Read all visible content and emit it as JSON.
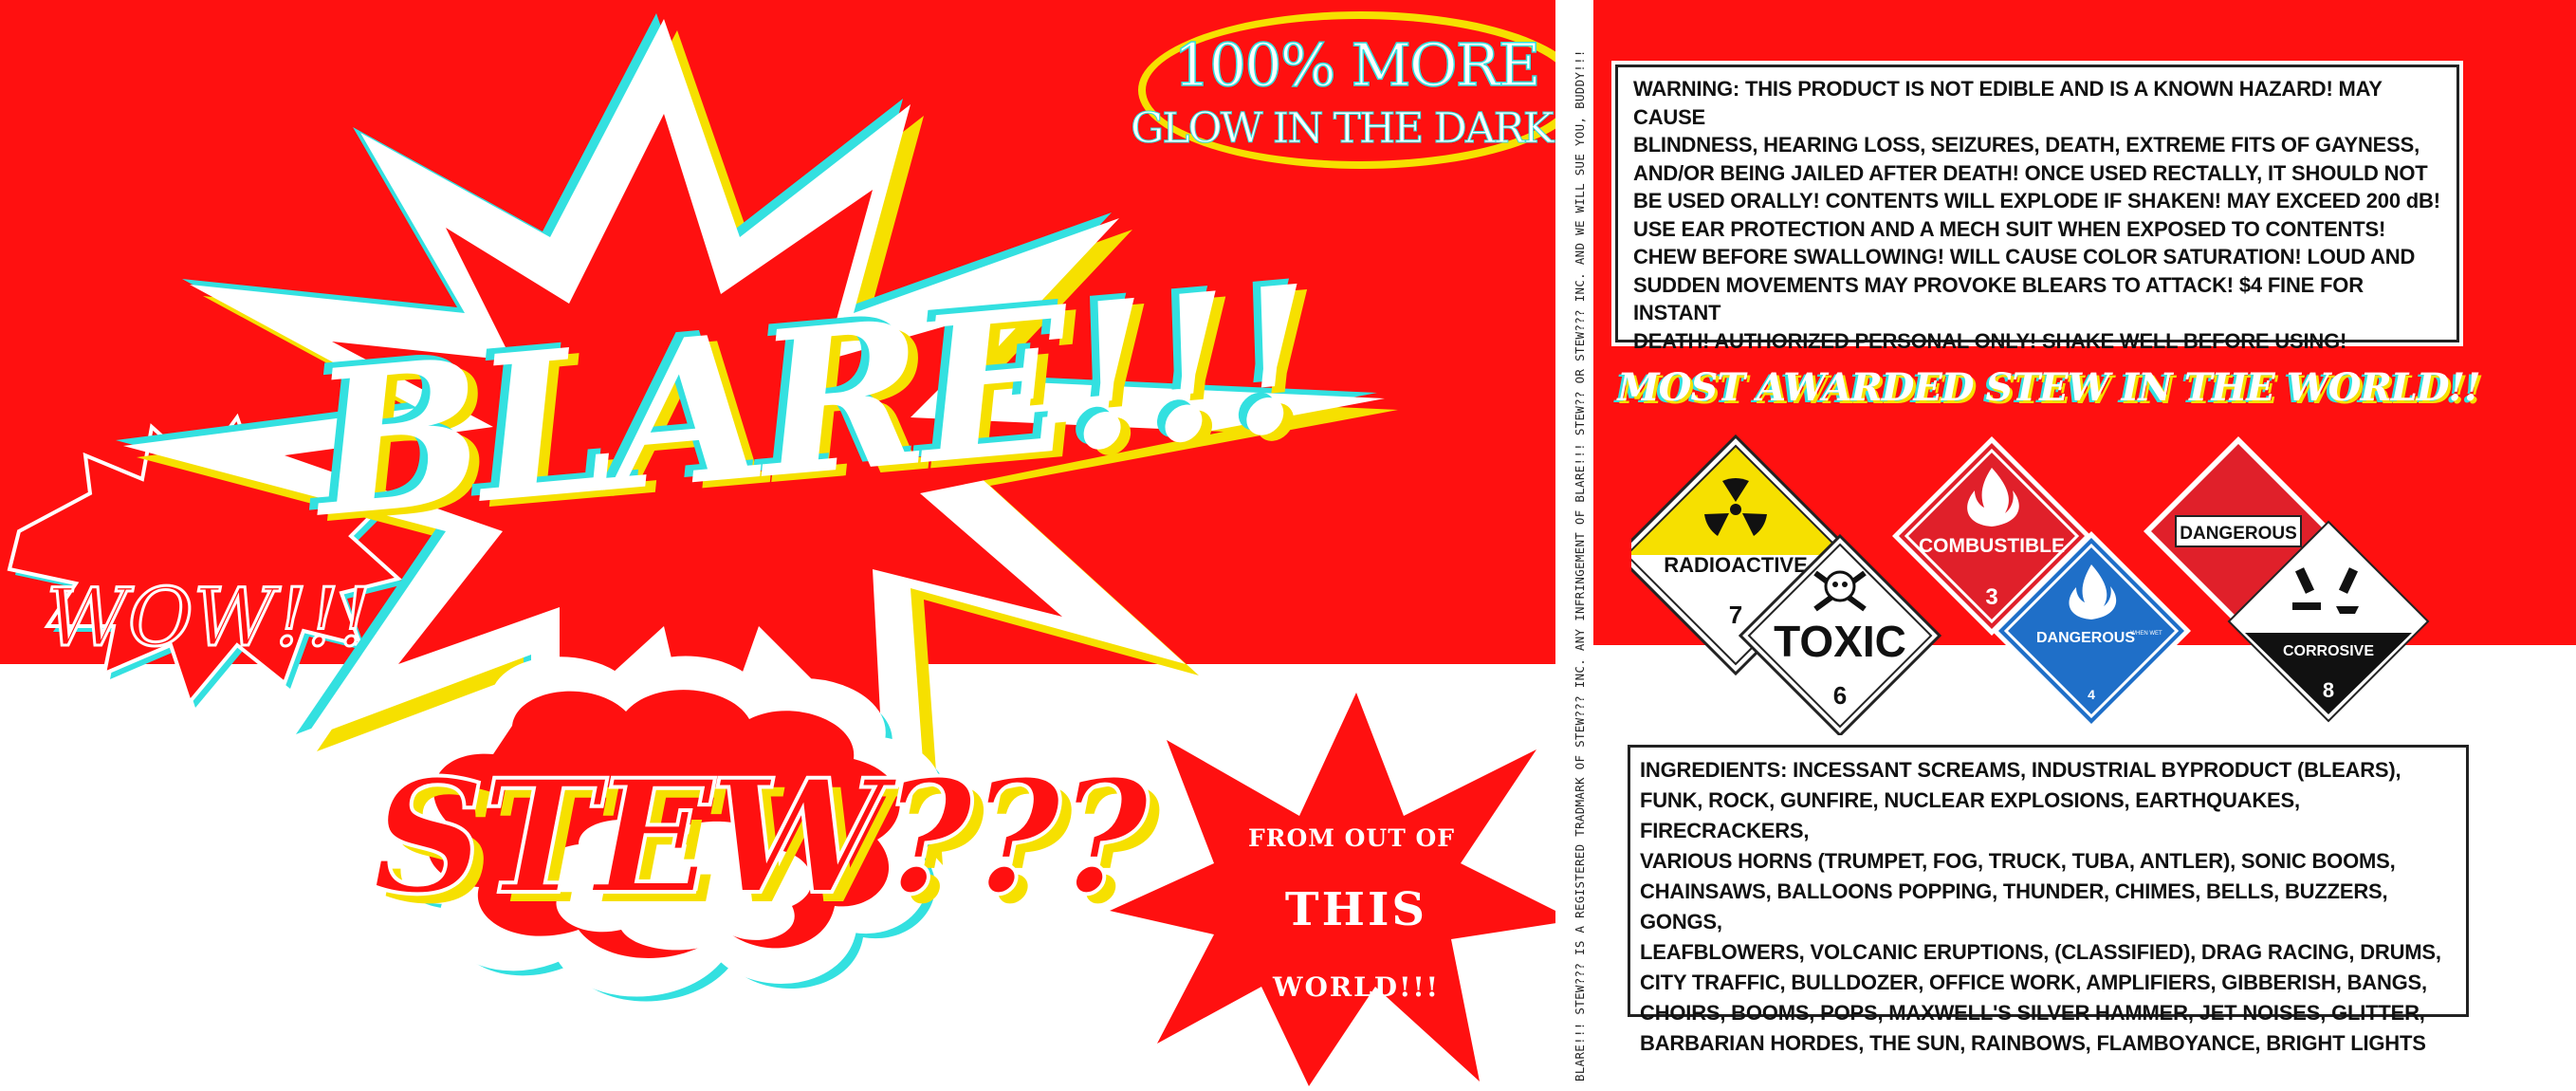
{
  "brand": {
    "blare": "BLARE!!!",
    "stew": "STEW???",
    "wow": "WOW!!!"
  },
  "badges": {
    "glow_line1": "100% MORE",
    "glow_line2": "GLOW IN THE DARK!!",
    "from_line1": "FROM OUT OF",
    "from_line2": "THIS",
    "from_line3": "WORLD!!!",
    "award": "MOST AWARDED STEW IN THE WORLD!!"
  },
  "warning": {
    "lines": [
      "WARNING: THIS PRODUCT IS NOT EDIBLE AND IS A KNOWN HAZARD! MAY CAUSE",
      "BLINDNESS, HEARING LOSS, SEIZURES, DEATH, EXTREME FITS OF GAYNESS,",
      "AND/OR BEING JAILED AFTER DEATH! ONCE USED RECTALLY, IT SHOULD NOT",
      "BE USED ORALLY! CONTENTS WILL EXPLODE IF SHAKEN! MAY EXCEED 200 dB!",
      "USE EAR PROTECTION AND A MECH SUIT WHEN EXPOSED TO CONTENTS!",
      "CHEW BEFORE SWALLOWING! WILL CAUSE COLOR SATURATION! LOUD AND",
      "SUDDEN MOVEMENTS MAY PROVOKE BLEARS TO ATTACK! $4 FINE FOR INSTANT",
      "DEATH! AUTHORIZED PERSONAL ONLY! SHAKE WELL BEFORE USING!"
    ]
  },
  "ingredients": {
    "lines": [
      "INGREDIENTS: INCESSANT SCREAMS, INDUSTRIAL BYPRODUCT (BLEARS),",
      "FUNK, ROCK, GUNFIRE, NUCLEAR EXPLOSIONS, EARTHQUAKES, FIRECRACKERS,",
      "VARIOUS HORNS (TRUMPET, FOG, TRUCK, TUBA, ANTLER), SONIC BOOMS,",
      "CHAINSAWS, BALLOONS POPPING, THUNDER, CHIMES, BELLS, BUZZERS, GONGS,",
      "LEAFBLOWERS, VOLCANIC ERUPTIONS, (CLASSIFIED), DRAG RACING, DRUMS,",
      "CITY TRAFFIC, BULLDOZER, OFFICE WORK, AMPLIFIERS, GIBBERISH, BANGS,",
      "CHOIRS, BOOMS, POPS, MAXWELL'S SILVER HAMMER, JET NOISES, GLITTER,",
      "BARBARIAN HORDES, THE SUN, RAINBOWS, FLAMBOYANCE, BRIGHT LIGHTS"
    ]
  },
  "legal": "BLARE!!! STEW??? IS A REGISTERED TRADMARK OF STEW??? INC. ANY INFRINGEMENT OF BLARE!!! STEW?? OR STEW??? INC. AND WE WILL SUE YOU, BUDDY!!!",
  "hazards": {
    "radioactive": {
      "label": "RADIOACTIVE",
      "class": "7",
      "icon": "radiation-icon"
    },
    "toxic": {
      "label": "TOXIC",
      "class": "6",
      "icon": "skull-crossbones-icon"
    },
    "combustible": {
      "label": "COMBUSTIBLE",
      "class": "3",
      "icon": "flame-icon"
    },
    "wet": {
      "label": "DANGEROUS",
      "sub": "WHEN WET",
      "class": "4",
      "icon": "flame-icon"
    },
    "dangerous": {
      "label": "DANGEROUS"
    },
    "corrosive": {
      "label": "CORROSIVE",
      "class": "8",
      "icon": "corrosive-icon"
    }
  },
  "colors": {
    "red": "#ff1010",
    "white": "#ffffff",
    "yellow": "#f6e000",
    "cyan": "#33e0e0",
    "blue": "#1f6fc8",
    "black": "#111111"
  }
}
